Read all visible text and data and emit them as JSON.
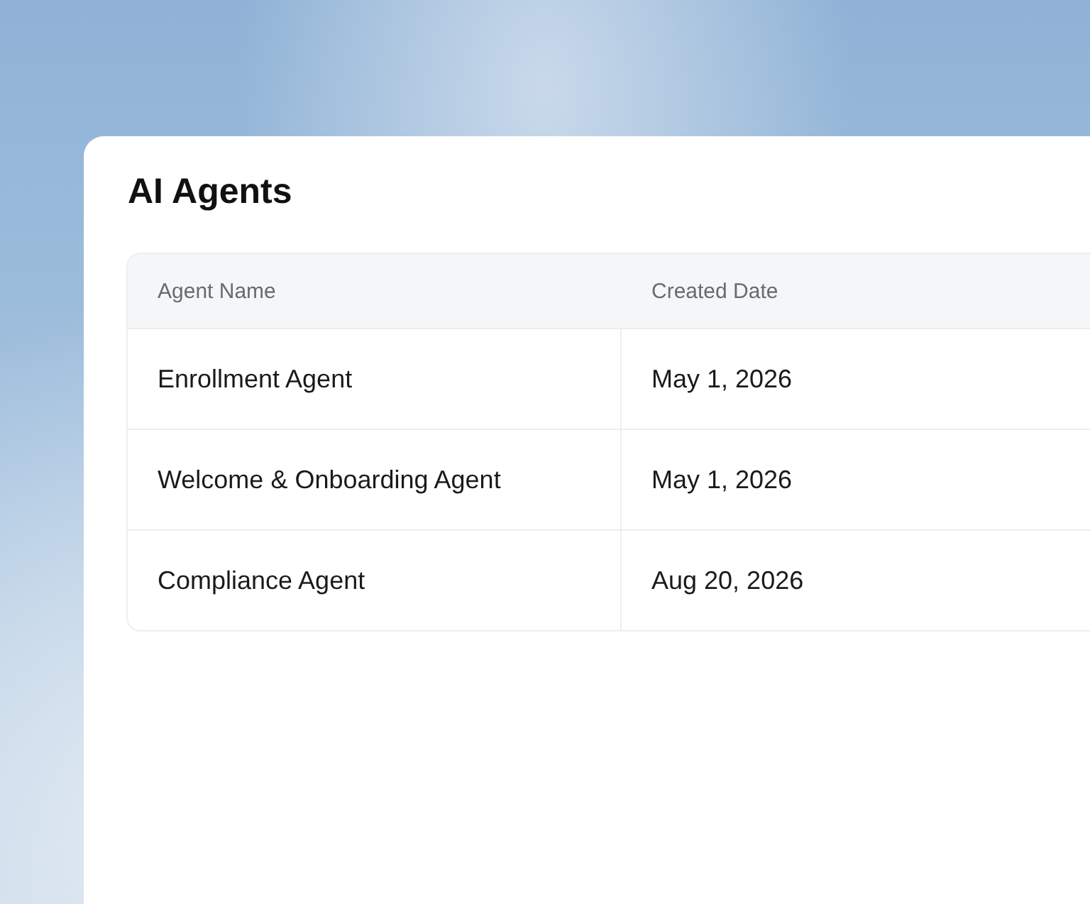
{
  "card": {
    "title": "AI Agents"
  },
  "table": {
    "columns": [
      "Agent Name",
      "Created Date"
    ],
    "rows": [
      {
        "name": "Enrollment Agent",
        "created": "May 1, 2026"
      },
      {
        "name": "Welcome & Onboarding Agent",
        "created": "May 1, 2026"
      },
      {
        "name": "Compliance Agent",
        "created": "Aug 20, 2026"
      }
    ]
  }
}
